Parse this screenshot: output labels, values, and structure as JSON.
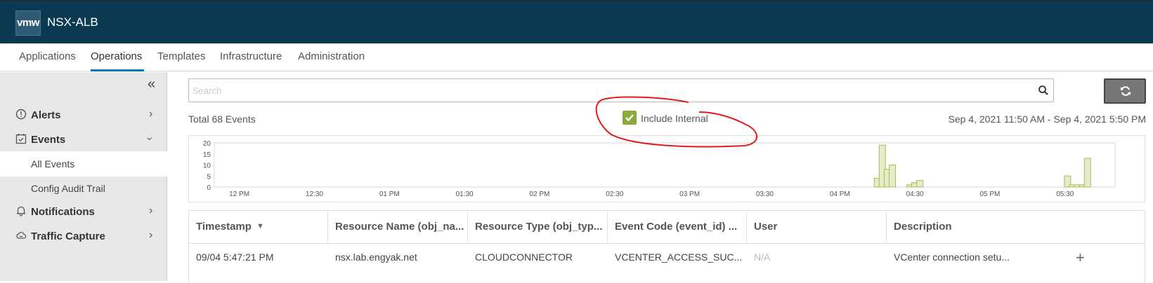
{
  "header": {
    "logo": "vmw",
    "title": "NSX-ALB"
  },
  "tabs": [
    "Applications",
    "Operations",
    "Templates",
    "Infrastructure",
    "Administration"
  ],
  "sidebar": {
    "items": [
      {
        "label": "Alerts",
        "icon": "alert-circle-icon"
      },
      {
        "label": "Events",
        "icon": "event-calendar-icon"
      },
      {
        "label": "All Events"
      },
      {
        "label": "Config Audit Trail"
      },
      {
        "label": "Notifications",
        "icon": "bell-icon"
      },
      {
        "label": "Traffic Capture",
        "icon": "cloud-capture-icon"
      }
    ]
  },
  "main": {
    "search_placeholder": "Search",
    "total_events": "Total 68 Events",
    "include_internal_label": "Include Internal",
    "include_internal_checked": true,
    "date_range": "Sep 4, 2021 11:50 AM - Sep 4, 2021 5:50 PM"
  },
  "chart_data": {
    "type": "bar",
    "y_ticks": [
      "20",
      "15",
      "10",
      "5",
      "0"
    ],
    "ylim": [
      0,
      20
    ],
    "x_ticks": [
      "12 PM",
      "12:30",
      "01 PM",
      "01:30",
      "02 PM",
      "02:30",
      "03 PM",
      "03:30",
      "04 PM",
      "04:30",
      "05 PM",
      "05:30"
    ],
    "bar_color": "#e4ecc9",
    "bar_border": "#a5bf54",
    "bars": [
      {
        "x": "04:15",
        "value": 4
      },
      {
        "x": "04:17",
        "value": 19
      },
      {
        "x": "04:19",
        "value": 8
      },
      {
        "x": "04:21",
        "value": 10
      },
      {
        "x": "04:28",
        "value": 1
      },
      {
        "x": "04:30",
        "value": 2
      },
      {
        "x": "04:32",
        "value": 3
      },
      {
        "x": "05:31",
        "value": 5
      },
      {
        "x": "05:33",
        "value": 1
      },
      {
        "x": "05:35",
        "value": 1
      },
      {
        "x": "05:37",
        "value": 1
      },
      {
        "x": "05:39",
        "value": 13
      }
    ]
  },
  "table": {
    "columns": [
      "Timestamp",
      "Resource Name (obj_na...",
      "Resource Type (obj_typ...",
      "Event Code (event_id) ...",
      "User",
      "Description"
    ],
    "rows": [
      [
        "09/04 5:47:21 PM",
        "nsx.lab.engyak.net",
        "CLOUDCONNECTOR",
        "VCENTER_ACCESS_SUC...",
        "N/A",
        "VCenter connection setu..."
      ]
    ]
  },
  "colors": {
    "header_bg": "#0c3a53",
    "accent": "#0079b8",
    "checkbox": "#8bac3c",
    "annotation": "#e11c1c"
  }
}
